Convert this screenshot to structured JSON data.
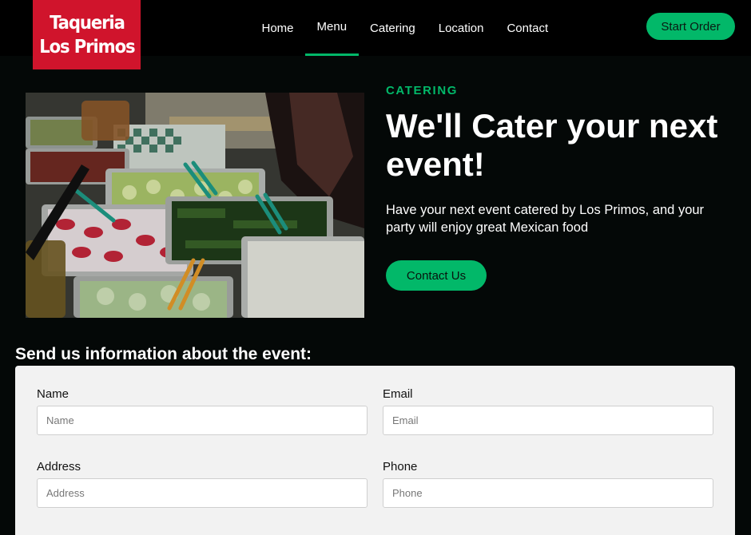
{
  "brand": {
    "line1": "Taqueria",
    "line2": "Los Primos",
    "color": "#d0142c"
  },
  "nav": {
    "items": [
      {
        "label": "Home",
        "active": false
      },
      {
        "label": "Menu",
        "active": true
      },
      {
        "label": "Catering",
        "active": false
      },
      {
        "label": "Location",
        "active": false
      },
      {
        "label": "Contact",
        "active": false
      }
    ],
    "cta_label": "Start Order"
  },
  "hero": {
    "eyebrow": "CATERING",
    "title": "We'll Cater your next event!",
    "description": "Have your next event catered by Los Primos, and your party will enjoy great Mexican food",
    "button_label": "Contact Us",
    "image": "catering-food-trays-photo"
  },
  "form": {
    "heading": "Send us information about the event:",
    "fields": {
      "name": {
        "label": "Name",
        "placeholder": "Name",
        "value": ""
      },
      "email": {
        "label": "Email",
        "placeholder": "Email",
        "value": ""
      },
      "address": {
        "label": "Address",
        "placeholder": "Address",
        "value": ""
      },
      "phone": {
        "label": "Phone",
        "placeholder": "Phone",
        "value": ""
      }
    }
  },
  "colors": {
    "accent": "#02b869",
    "background": "#040807",
    "header": "#000000",
    "form_bg": "#f2f2f2"
  }
}
